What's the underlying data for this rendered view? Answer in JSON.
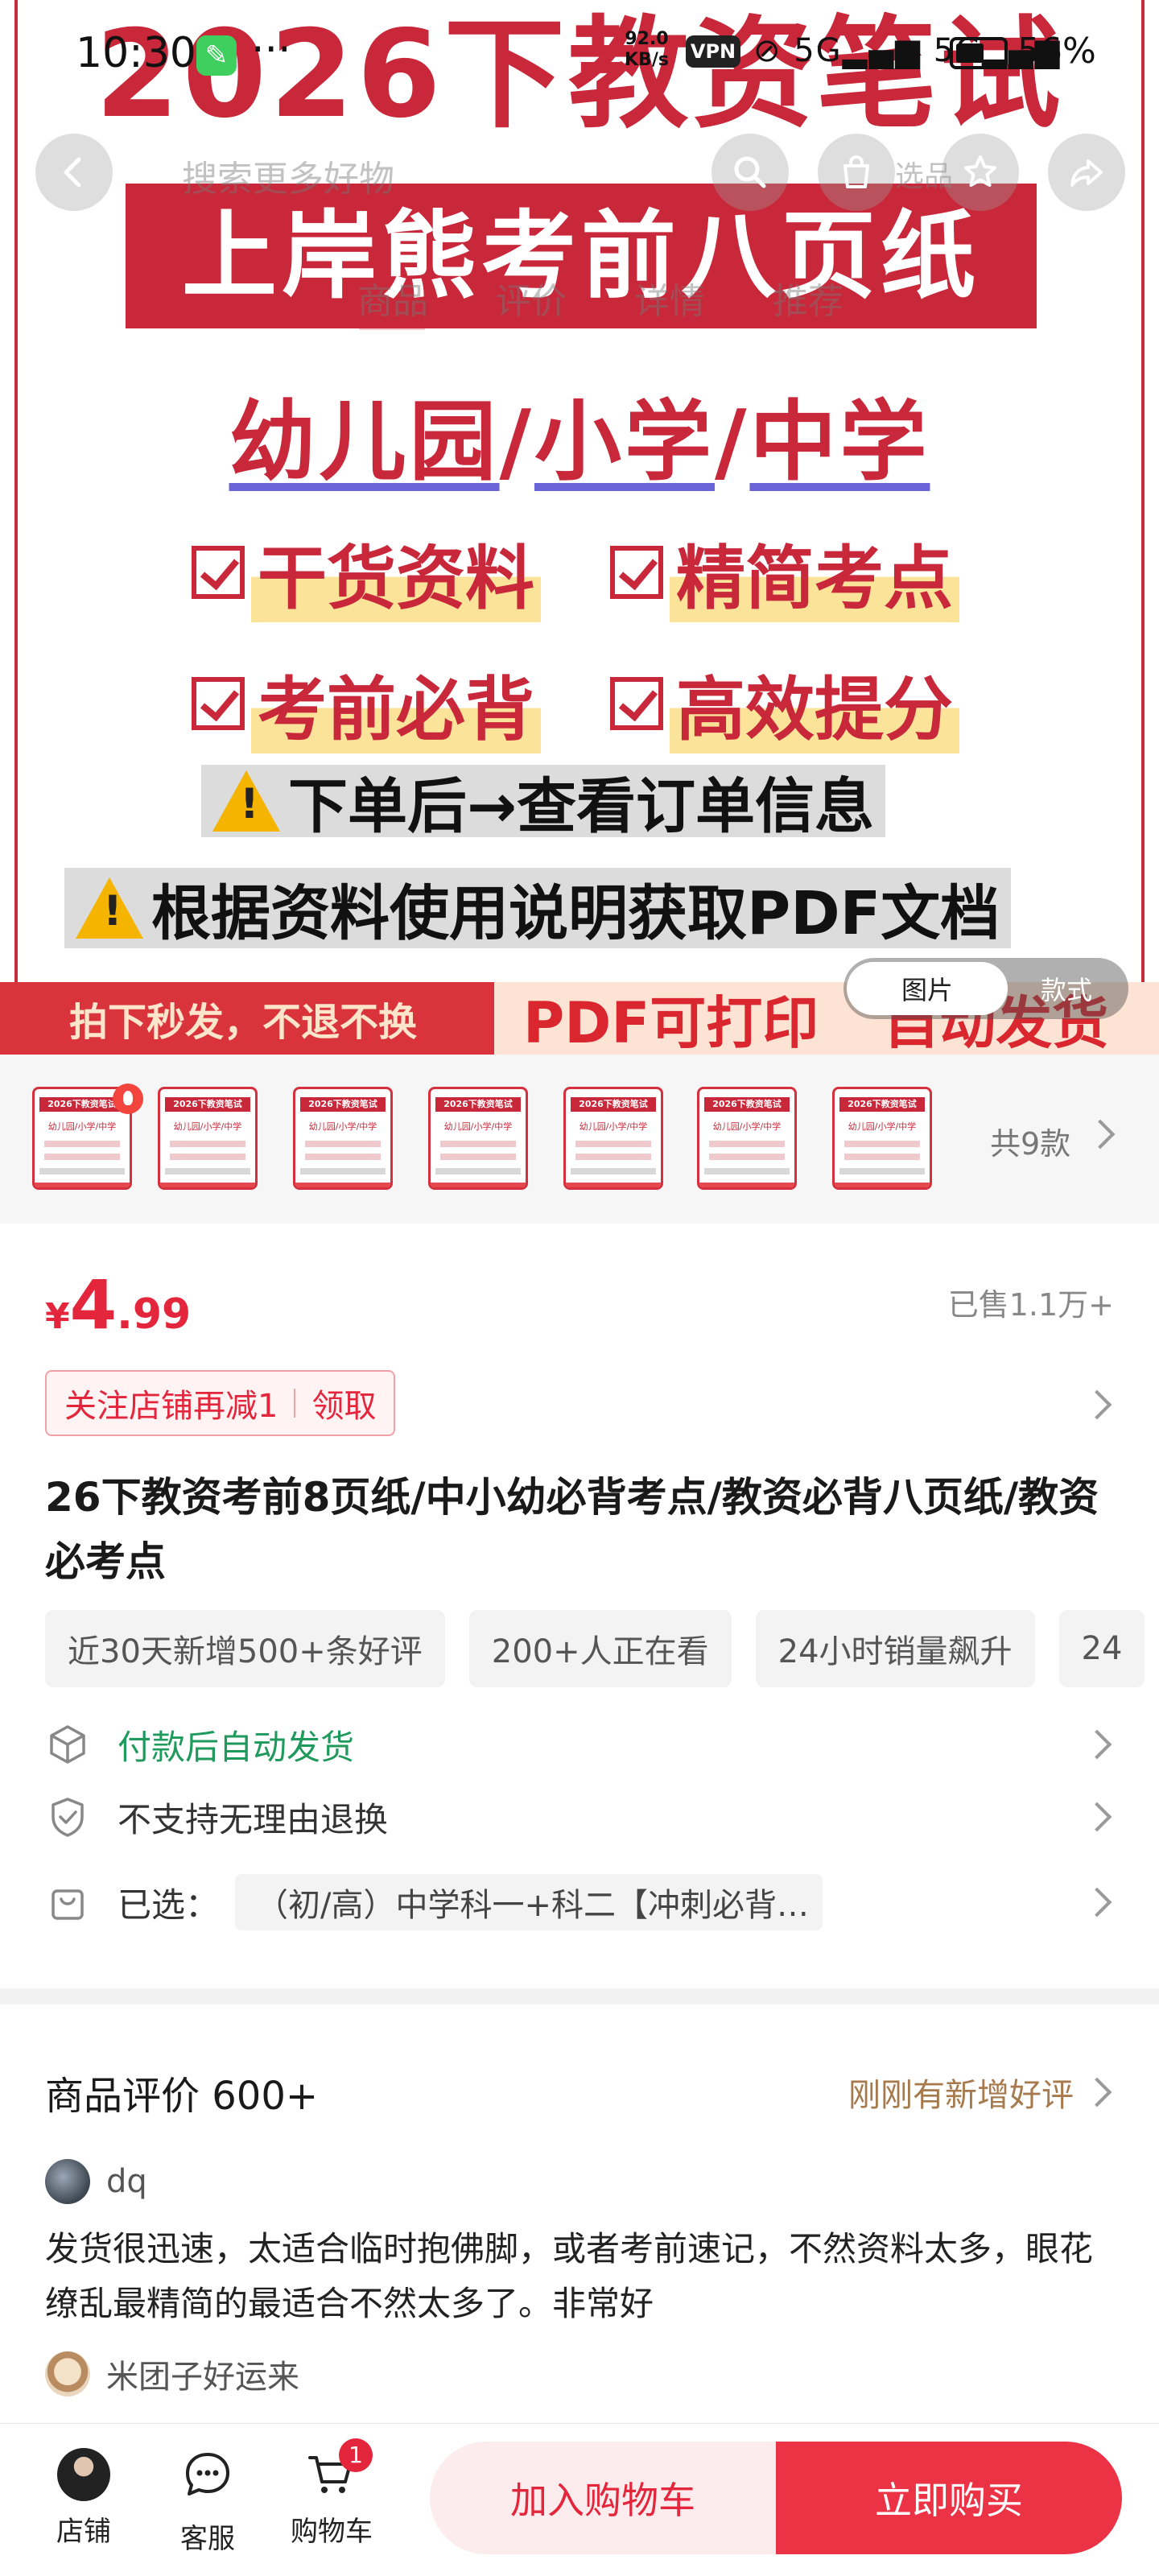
{
  "status_bar": {
    "time": "10:30",
    "more": "···",
    "speed_value": "92.0",
    "speed_unit": "KB/s",
    "vpn": "VPN",
    "network_1": "5G",
    "network_2": "5G",
    "battery": "56%"
  },
  "overlay": {
    "search_placeholder": "搜索更多好物",
    "tabs": "商品 评价 详情 推荐",
    "select": "选品",
    "view_toggle": {
      "selected": "图片",
      "other": "款式"
    }
  },
  "hero": {
    "title": "2026下教资笔试",
    "banner": "上岸熊考前八页纸",
    "levels": [
      "幼儿园",
      "小学",
      "中学"
    ],
    "level_sep": "/",
    "features": [
      "干货资料",
      "精简考点",
      "考前必背",
      "高效提分"
    ],
    "notice_1": "下单后→查看订单信息",
    "notice_2": "根据资料使用说明获取PDF文档",
    "bottom_left": "拍下秒发，不退不换",
    "bottom_mid": "PDF可打印",
    "bottom_right": "自动发货"
  },
  "thumbnails": {
    "mini_title": "2026下教资笔试",
    "mini_levels": "幼儿园/小学/中学",
    "count_label": "共9款",
    "items": 7
  },
  "product": {
    "currency": "¥",
    "price_int": "4",
    "price_dec": ".99",
    "sold": "已售1.1万+",
    "coupon_text": "关注店铺再减1",
    "coupon_action": "领取",
    "title": "26下教资考前8页纸/中小幼必背考点/教资必背八页纸/教资必考点",
    "tags": [
      "近30天新增500+条好评",
      "200+人正在看",
      "24小时销量飙升",
      "24"
    ],
    "service_1": "付款后自动发货",
    "service_2": "不支持无理由退换",
    "selected_label": "已选：",
    "selected_value": "（初/高）中学科一+科二【冲刺必背…"
  },
  "reviews": {
    "title": "商品评价 600+",
    "new_badge": "刚刚有新增好评",
    "user_1": "dq",
    "text_1": "发货很迅速，太适合临时抱佛脚，或者考前速记，不然资料太多，眼花缭乱最精简的最适合不然太多了。非常好",
    "user_2": "米团子好运来"
  },
  "bottom_bar": {
    "shop": "店铺",
    "service": "客服",
    "cart": "购物车",
    "cart_count": "1",
    "add_to_cart": "加入购物车",
    "buy_now": "立即购买"
  },
  "colors": {
    "brand_red": "#c8283a",
    "price_red": "#e3263b",
    "service_green": "#1f9a5c",
    "review_gold": "#a77a4e"
  }
}
